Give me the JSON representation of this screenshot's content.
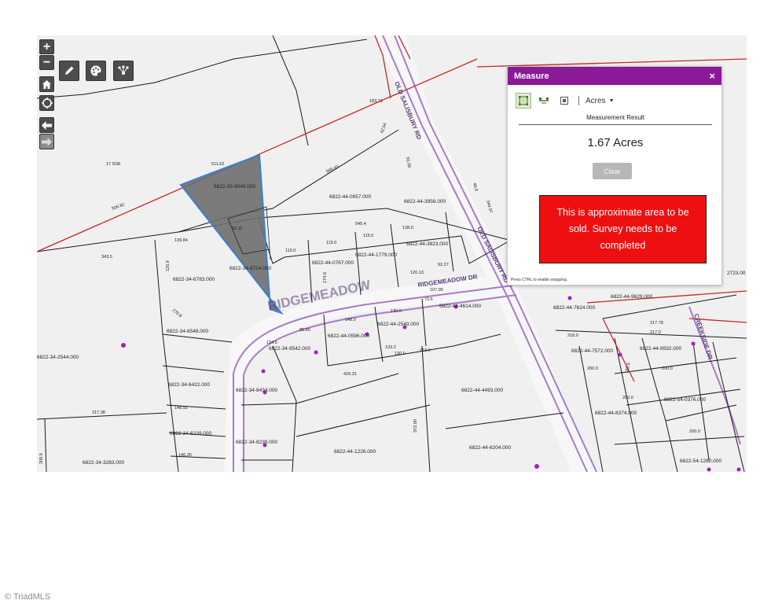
{
  "controls": {
    "zoom_in": "+",
    "zoom_out": "−"
  },
  "measure": {
    "title": "Measure",
    "close": "×",
    "units": "Acres",
    "result_title": "Measurement Result",
    "result_value": "1.67 Acres",
    "clear_label": "Clear",
    "snapping_note": "Press CTRL to enable snapping."
  },
  "annotation": "This is approximate area to be sold.  Survey needs to be completed",
  "roads": {
    "old_salisbury": "OLD SALISBURY RD",
    "old_salisbury_2": "OLD SALISBURY RD",
    "ridgemeadow": "RIDGEMEADOW DR",
    "ridgemeadow_large": "RIDGEMEADOW",
    "creekside": "CREEKSIDE DR"
  },
  "parcels": {
    "p8046": "6822-35-8046.000",
    "p0957": "6822-44-0957.000",
    "p3956": "6822-44-3956.000",
    "p3823": "6822-44-3823.000",
    "p1779": "6822-44-1779.000",
    "p0767": "6822-44-0767.000",
    "p8724": "6822-34-8724.000",
    "p6783": "6822-34-6783.000",
    "p6548": "6822-34-6548.000",
    "p2544": "6822-34-2544.000",
    "p9542": "6822-34-9542.000",
    "p0596": "6822-44-0596.000",
    "p2549": "6822-44-2549.000",
    "p4614": "6822-44-4614.000",
    "p6422": "6822-34-6422.000",
    "p8434": "6822-34-8434.000",
    "p6239": "6822-34-6239.000",
    "p8239": "6822-34-8239.000",
    "p3283": "6822-34-3283.000",
    "p1226": "6822-44-1226.000",
    "p4493": "6822-44-4493.000",
    "p6204": "6822-44-6204.000",
    "p7624": "6822-44-7624.000",
    "p9629": "6822-44-9629.000",
    "p7572": "6822-44-7572.000",
    "p9592": "6822-44-9592.000",
    "p8374": "6822-44-8374.000",
    "p0376": "6822-54-0376.000",
    "p1260": "6822-54-1260.000",
    "p2723": "2723.00"
  },
  "dimensions": {
    "d511": "511.62",
    "d506": "506.82",
    "d586": "586.43",
    "d545": "545.4",
    "d343": "343.5",
    "d139": "139.84",
    "d125": "125.9",
    "d115a": "115.0",
    "d115b": "115.0",
    "d115c": "115.0",
    "d138": "138.0",
    "d174": "174.0",
    "d120": "120.13",
    "d92": "92.27",
    "d107": "107.95",
    "d73": "73.6",
    "d85": "85.65",
    "d148": "148.0",
    "d130": "130.0",
    "d134": "134.5",
    "d133": "133.2",
    "d130c": "130.0",
    "d429": "429.31",
    "d148b": "148.92",
    "d317": "317.38",
    "d146": "146.26",
    "d263": "263.0",
    "d372": "372.00",
    "d218": "218.0",
    "d217a": "217.78",
    "d217b": "217.0",
    "d200a": "200.0",
    "d200b": "200.0",
    "d200c": "200.0",
    "d200d": "200.0",
    "d180": "180.5",
    "d91": "91.06",
    "d42": "42.54",
    "d46": "46.8",
    "d344": "344.97",
    "d183": "183.71",
    "d270": "270.8",
    "d60": "60.11",
    "d17": "17 SS8",
    "d208": "208.9"
  },
  "colors": {
    "property_fill": "#6e6e6e",
    "property_outline": "#3a7fd0",
    "boundary_red": "#c62828",
    "road_purple": "#a77bc8",
    "panel_header": "#8a1a96",
    "annotation_red": "#ee1010"
  },
  "watermark": "© TriadMLS"
}
